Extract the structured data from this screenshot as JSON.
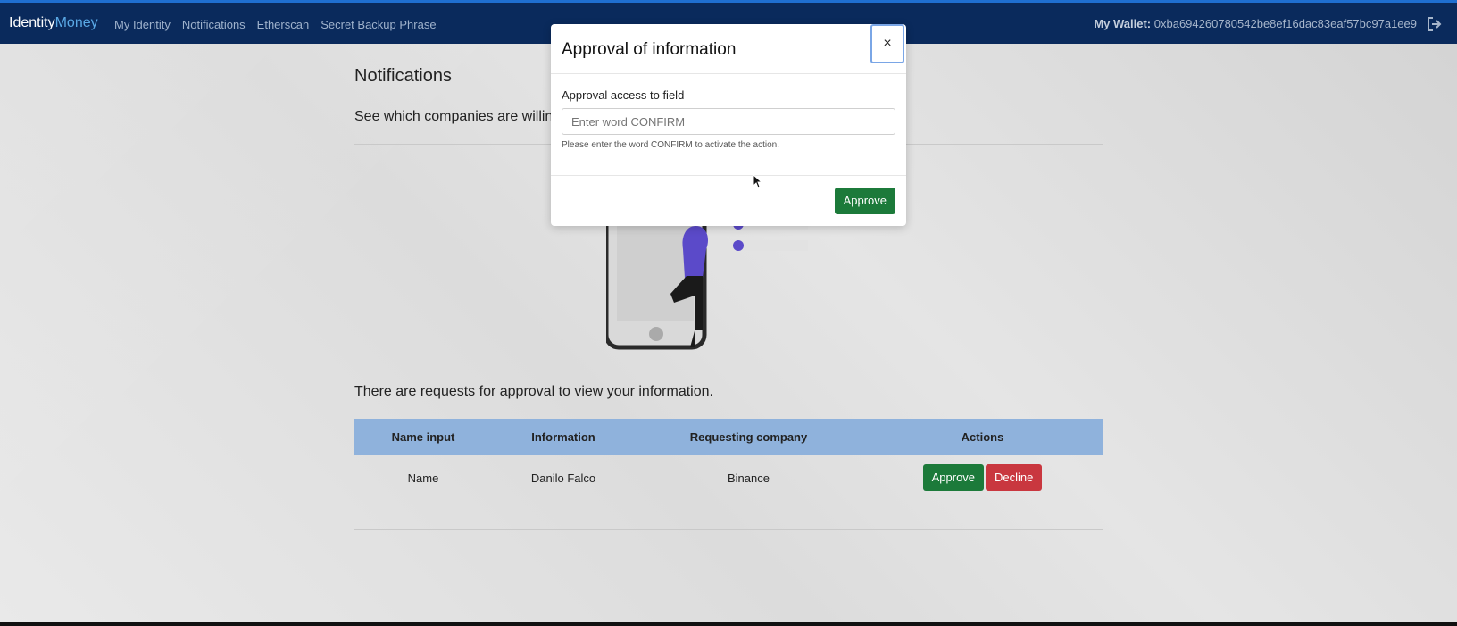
{
  "navbar": {
    "brand_primary": "Identity",
    "brand_secondary": "Money",
    "links": [
      "My Identity",
      "Notifications",
      "Etherscan",
      "Secret Backup Phrase"
    ],
    "wallet_label": "My Wallet:",
    "wallet_address": "0xba694260780542be8ef16dac83eaf57bc97a1ee9"
  },
  "page": {
    "title": "Notifications",
    "lead": "See which companies are willing",
    "requests_text": "There are requests for approval to view your information."
  },
  "table": {
    "headers": [
      "Name input",
      "Information",
      "Requesting company",
      "Actions"
    ],
    "rows": [
      {
        "name_input": "Name",
        "information": "Danilo Falco",
        "company": "Binance",
        "approve": "Approve",
        "decline": "Decline"
      }
    ]
  },
  "modal": {
    "title": "Approval of information",
    "close": "×",
    "field_label": "Approval access to field",
    "input_placeholder": "Enter word CONFIRM",
    "help_text": "Please enter the word CONFIRM to activate the action.",
    "approve_label": "Approve"
  },
  "colors": {
    "navbar": "#0a2a5c",
    "table_header": "#8fb2dc",
    "approve": "#1c7a3a",
    "decline": "#c9373f",
    "illustration_accent": "#5b4ac9"
  }
}
